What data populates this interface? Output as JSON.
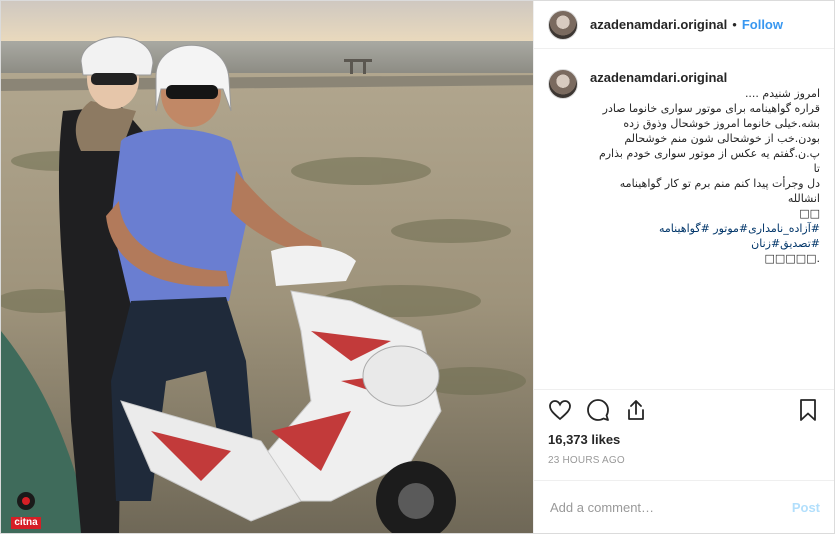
{
  "post": {
    "username": "azadenamdari.original",
    "separator": "•",
    "follow_label": "Follow",
    "caption": {
      "username": "azadenamdari.original",
      "lines": [
        "امروز شنیدم ....",
        "قراره گواهینامه برای موتور سواری خانوما صادر",
        "بشه.خیلی خانوما امروز خوشحال وذوق زده",
        "بودن.خب از خوشحالی شون منم خوشحالم",
        "پ.ن.گفتم یه عکس از موتور سواری خودم بذارم تا",
        "دل وجرأت پیدا کنم منم برم تو کار گواهینامه انشالله",
        "□□",
        "#آزاده_نامداری#موتور #گواهینامه #تصدیق#زنان",
        ".□□□□□"
      ]
    },
    "likes": "16,373 likes",
    "time": "23 HOURS AGO",
    "comment_placeholder": "Add a comment…",
    "post_label": "Post",
    "watermark": "citna"
  },
  "icons": {
    "like": "heart-icon",
    "comment": "comment-icon",
    "share": "share-icon",
    "save": "bookmark-icon"
  },
  "colors": {
    "follow": "#3897f0",
    "post_disabled": "#b2dffc",
    "hashtag": "#003569",
    "meta": "#999999"
  }
}
